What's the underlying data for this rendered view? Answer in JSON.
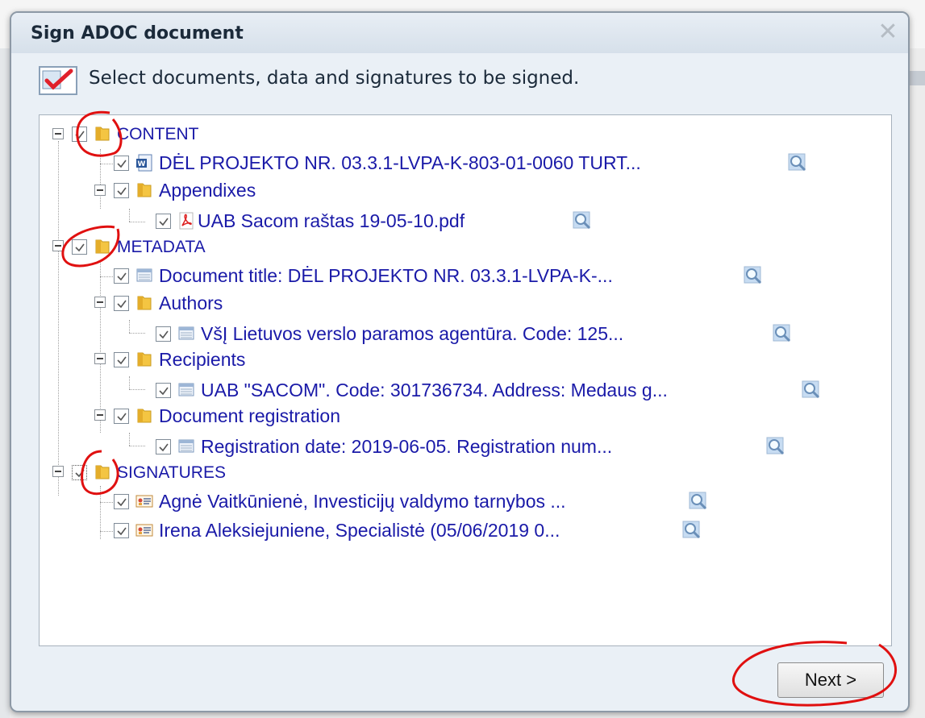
{
  "dialog": {
    "title": "Sign ADOC document",
    "instruction": "Select documents, data and signatures to be signed.",
    "next_label": "Next >"
  },
  "tree": [
    {
      "label": "CONTENT",
      "icon": "folder-icon",
      "checked": true
    },
    {
      "label": "DĖL PROJEKTO NR. 03.3.1-LVPA-K-803-01-0060 TURT...",
      "icon": "word-doc-icon",
      "checked": true
    },
    {
      "label": "Appendixes",
      "icon": "folder-icon",
      "checked": true
    },
    {
      "label": "UAB Sacom raštas 19-05-10.pdf",
      "icon": "pdf-icon",
      "checked": true
    },
    {
      "label": "METADATA",
      "icon": "folder-icon",
      "checked": true
    },
    {
      "label": "Document title: DĖL PROJEKTO NR. 03.3.1-LVPA-K-...",
      "icon": "metadata-icon",
      "checked": true
    },
    {
      "label": "Authors",
      "icon": "folder-icon",
      "checked": true
    },
    {
      "label": "VšĮ Lietuvos verslo paramos agentūra. Code: 125...",
      "icon": "metadata-icon",
      "checked": true
    },
    {
      "label": "Recipients",
      "icon": "folder-icon",
      "checked": true
    },
    {
      "label": "UAB \"SACOM\". Code: 301736734. Address: Medaus g...",
      "icon": "metadata-icon",
      "checked": true
    },
    {
      "label": "Document registration",
      "icon": "folder-icon",
      "checked": true
    },
    {
      "label": "Registration date: 2019-06-05. Registration num...",
      "icon": "metadata-icon",
      "checked": true
    },
    {
      "label": "SIGNATURES",
      "icon": "folder-icon",
      "checked": true
    },
    {
      "label": "Agnė Vaitkūnienė, Investicijų valdymo tarnybos ...",
      "icon": "signature-card-icon",
      "checked": true
    },
    {
      "label": "Irena Aleksiejuniene, Specialistė (05/06/2019 0...",
      "icon": "signature-card-icon",
      "checked": true
    }
  ],
  "colors": {
    "accent": "#1a1aa8",
    "annotation": "#e01010"
  }
}
